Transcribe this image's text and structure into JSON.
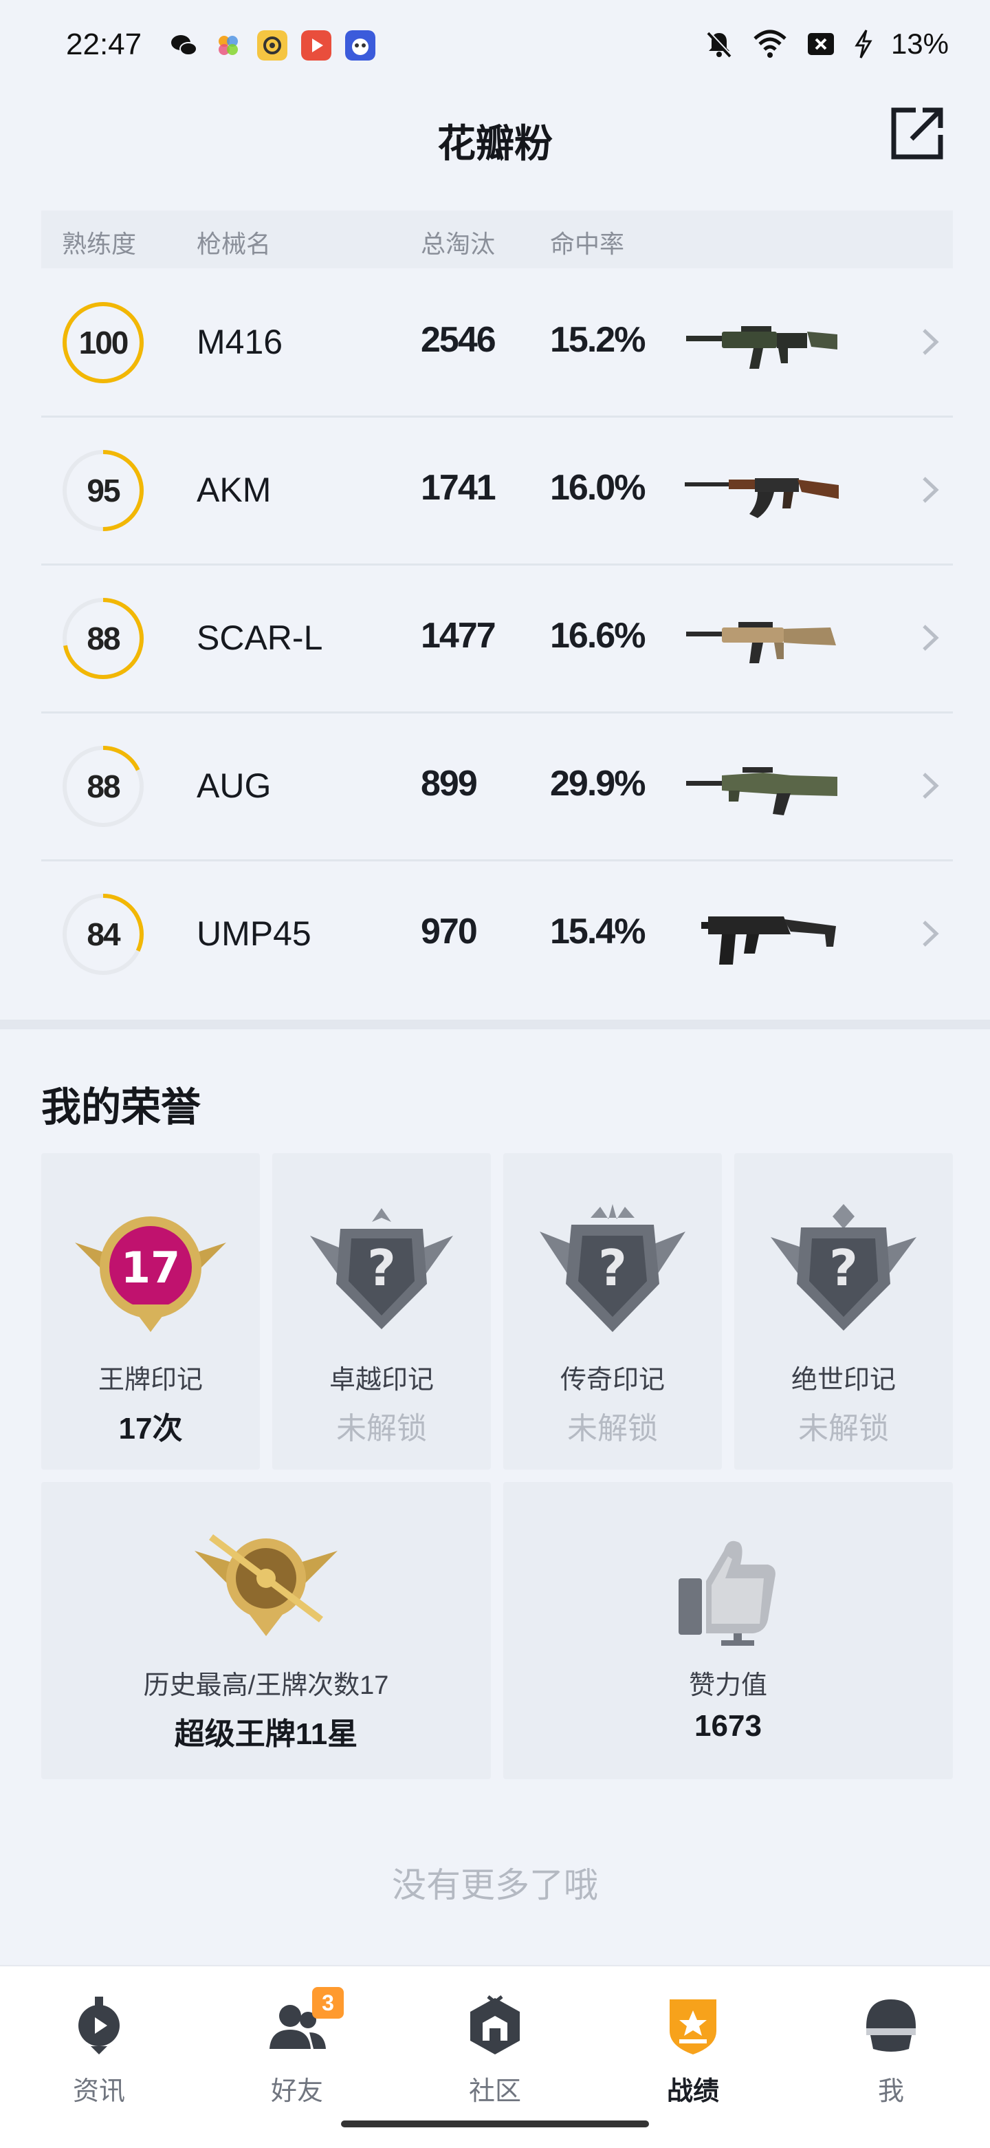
{
  "status_bar": {
    "time": "22:47",
    "battery": "13%",
    "app_icons": [
      "wechat-icon",
      "photos-icon",
      "yellow-app-icon",
      "video-app-icon",
      "game-app-icon"
    ]
  },
  "header": {
    "title": "花瓣粉"
  },
  "weapon_table": {
    "columns": {
      "proficiency": "熟练度",
      "weapon_name": "枪械名",
      "eliminations": "总淘汰",
      "hit_rate": "命中率"
    },
    "rows": [
      {
        "level": "100",
        "progress": 1.0,
        "name": "M416",
        "eliminations": "2546",
        "hit_rate": "15.2%",
        "gun": "m416"
      },
      {
        "level": "95",
        "progress": 0.5,
        "name": "AKM",
        "eliminations": "1741",
        "hit_rate": "16.0%",
        "gun": "akm"
      },
      {
        "level": "88",
        "progress": 0.72,
        "name": "SCAR-L",
        "eliminations": "1477",
        "hit_rate": "16.6%",
        "gun": "scar"
      },
      {
        "level": "88",
        "progress": 0.18,
        "name": "AUG",
        "eliminations": "899",
        "hit_rate": "29.9%",
        "gun": "aug"
      },
      {
        "level": "84",
        "progress": 0.32,
        "name": "UMP45",
        "eliminations": "970",
        "hit_rate": "15.4%",
        "gun": "ump"
      }
    ]
  },
  "honors": {
    "title": "我的荣誉",
    "seals": [
      {
        "name": "王牌印记",
        "value": "17次",
        "badge_number": "17",
        "locked": false
      },
      {
        "name": "卓越印记",
        "value": "未解锁",
        "locked": true
      },
      {
        "name": "传奇印记",
        "value": "未解锁",
        "locked": true
      },
      {
        "name": "绝世印记",
        "value": "未解锁",
        "locked": true
      }
    ],
    "highest": {
      "label": "历史最高/王牌次数17",
      "value": "超级王牌11星"
    },
    "likes": {
      "label": "赞力值",
      "value": "1673"
    }
  },
  "no_more_text": "没有更多了哦",
  "tabs": [
    {
      "label": "资讯",
      "icon": "news-icon",
      "active": false
    },
    {
      "label": "好友",
      "icon": "friends-icon",
      "active": false,
      "badge": "3"
    },
    {
      "label": "社区",
      "icon": "community-icon",
      "active": false
    },
    {
      "label": "战绩",
      "icon": "stats-icon",
      "active": true
    },
    {
      "label": "我",
      "icon": "profile-icon",
      "active": false
    }
  ],
  "colors": {
    "accent": "#f2b705",
    "ring_track": "#e6e9ee",
    "background": "#f0f3f9",
    "badge": "#ff9a2e"
  }
}
